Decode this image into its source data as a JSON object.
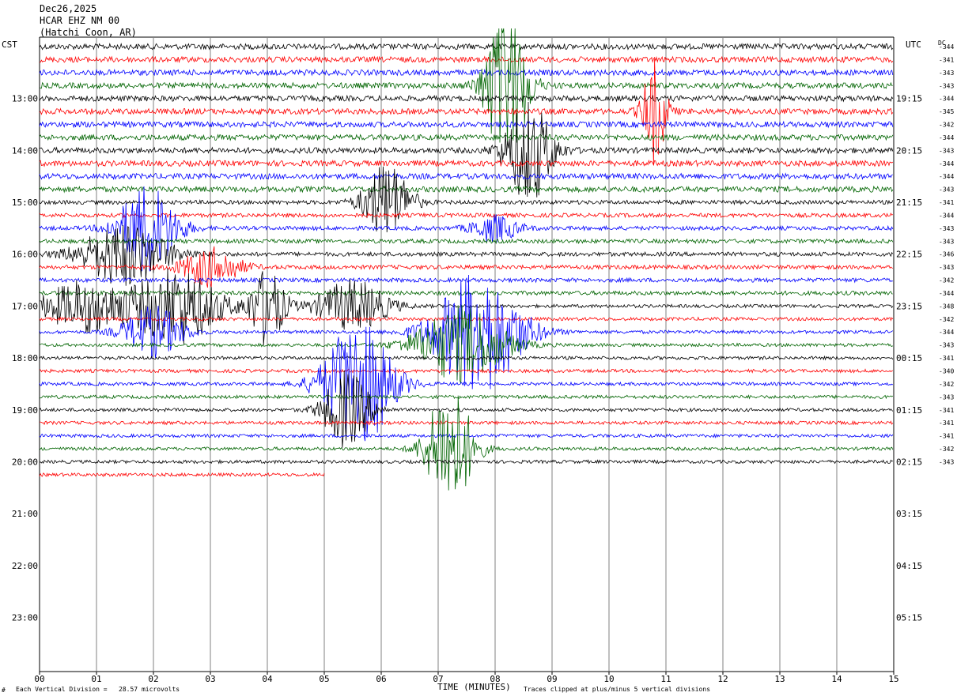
{
  "header": {
    "date": "Dec26,2025",
    "station": "HCAR EHZ NM 00",
    "location": "(Hatchi Coon, AR)"
  },
  "left_zone": "CST",
  "right_zone": "UTC",
  "dc_label": "DC",
  "footer": {
    "vertical_division": "Each Vertical Division =   28.57 microvolts",
    "clipping_note": "Traces clipped at plus/minus 5 vertical divisions",
    "corner_mark": "#"
  },
  "colors": {
    "cycle": [
      "#000000",
      "#ff0000",
      "#0000ff",
      "#006400"
    ],
    "grid": "#808080"
  },
  "chart_data": {
    "type": "line",
    "title": "",
    "xlabel": "TIME (MINUTES)",
    "x_ticks": [
      "00",
      "01",
      "02",
      "03",
      "04",
      "05",
      "06",
      "07",
      "08",
      "09",
      "10",
      "11",
      "12",
      "13",
      "14",
      "15"
    ],
    "xlim": [
      0,
      15
    ],
    "left_hour_labels": [
      "13:00",
      "14:00",
      "15:00",
      "16:00",
      "17:00",
      "18:00",
      "19:00",
      "20:00",
      "21:00",
      "22:00",
      "23:00"
    ],
    "right_hour_labels": [
      "19:15",
      "20:15",
      "21:15",
      "22:15",
      "23:15",
      "00:15",
      "01:15",
      "02:15",
      "03:15",
      "04:15",
      "05:15"
    ],
    "rows_per_hour": 4,
    "minutes_per_row": 15,
    "trace_count": 34,
    "last_trace_end_minute": 5.0,
    "dc_offsets": [
      "-344",
      "-341",
      "-343",
      "-343",
      "-344",
      "-345",
      "-342",
      "-344",
      "-343",
      "-344",
      "-344",
      "-343",
      "-341",
      "-344",
      "-343",
      "-343",
      "-346",
      "-343",
      "-342",
      "-344",
      "-348",
      "-342",
      "-344",
      "-343",
      "-341",
      "-340",
      "-342",
      "-343",
      "-341",
      "-341",
      "-341",
      "-342",
      "-343"
    ],
    "events": [
      {
        "row": 3,
        "minute": 8.2,
        "amplitude": 7,
        "duration_min": 0.7
      },
      {
        "row": 5,
        "minute": 10.8,
        "amplitude": 4,
        "duration_min": 0.4
      },
      {
        "row": 8,
        "minute": 8.6,
        "amplitude": 4,
        "duration_min": 0.8
      },
      {
        "row": 12,
        "minute": 6.1,
        "amplitude": 3,
        "duration_min": 0.8
      },
      {
        "row": 14,
        "minute": 1.9,
        "amplitude": 3.5,
        "duration_min": 1.0
      },
      {
        "row": 14,
        "minute": 8.0,
        "amplitude": 1,
        "duration_min": 0.8
      },
      {
        "row": 16,
        "minute": 1.5,
        "amplitude": 2.5,
        "duration_min": 1.5
      },
      {
        "row": 17,
        "minute": 3.0,
        "amplitude": 1.5,
        "duration_min": 1.0
      },
      {
        "row": 20,
        "minute": 0.8,
        "amplitude": 2,
        "duration_min": 1.5
      },
      {
        "row": 20,
        "minute": 2.4,
        "amplitude": 3,
        "duration_min": 1.5
      },
      {
        "row": 20,
        "minute": 4.0,
        "amplitude": 3,
        "duration_min": 0.6
      },
      {
        "row": 20,
        "minute": 5.5,
        "amplitude": 2,
        "duration_min": 1.2
      },
      {
        "row": 22,
        "minute": 2.0,
        "amplitude": 2,
        "duration_min": 1.0
      },
      {
        "row": 22,
        "minute": 7.7,
        "amplitude": 5,
        "duration_min": 1.5
      },
      {
        "row": 23,
        "minute": 7.4,
        "amplitude": 3,
        "duration_min": 1.5
      },
      {
        "row": 26,
        "minute": 5.6,
        "amplitude": 5,
        "duration_min": 1.2
      },
      {
        "row": 28,
        "minute": 5.4,
        "amplitude": 3,
        "duration_min": 0.8
      },
      {
        "row": 31,
        "minute": 7.2,
        "amplitude": 5,
        "duration_min": 0.8
      }
    ]
  }
}
